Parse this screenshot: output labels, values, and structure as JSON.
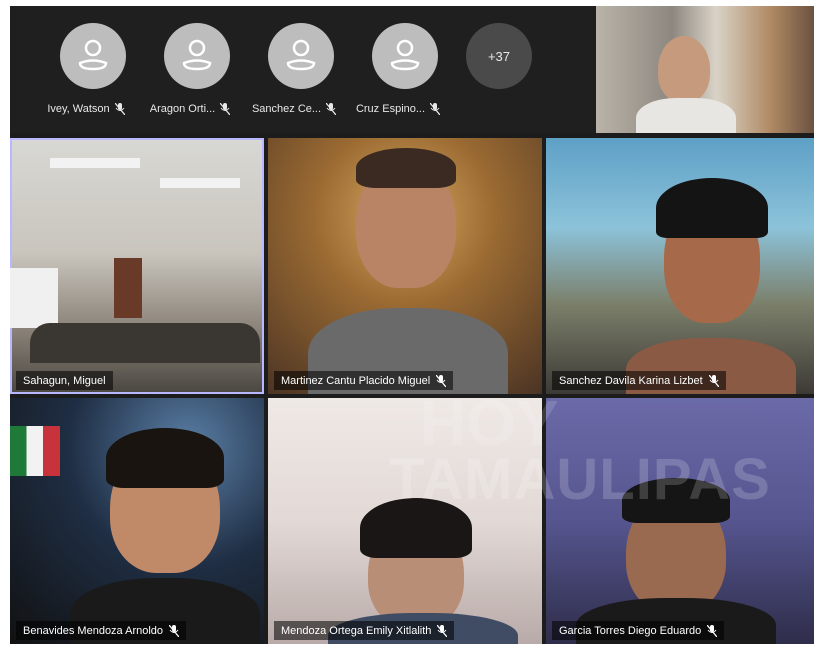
{
  "audio_participants": [
    {
      "name": "Ivey, Watson"
    },
    {
      "name": "Aragon Orti..."
    },
    {
      "name": "Sanchez Ce..."
    },
    {
      "name": "Cruz Espino..."
    }
  ],
  "more_participants": "+37",
  "video_tiles": [
    {
      "name": "Sahagun, Miguel"
    },
    {
      "name": "Martinez Cantu Placido Miguel"
    },
    {
      "name": "Sanchez Davila Karina Lizbet"
    },
    {
      "name": "Benavides Mendoza Arnoldo"
    },
    {
      "name": "Mendoza Ortega Emily Xitlalith"
    },
    {
      "name": "Garcia Torres Diego Eduardo"
    }
  ],
  "watermark": {
    "line1": "HOY",
    "line2": "TAMAULIPAS"
  },
  "colors": {
    "active_speaker_border": "#b9b7ff",
    "background": "#1c1c1c"
  }
}
